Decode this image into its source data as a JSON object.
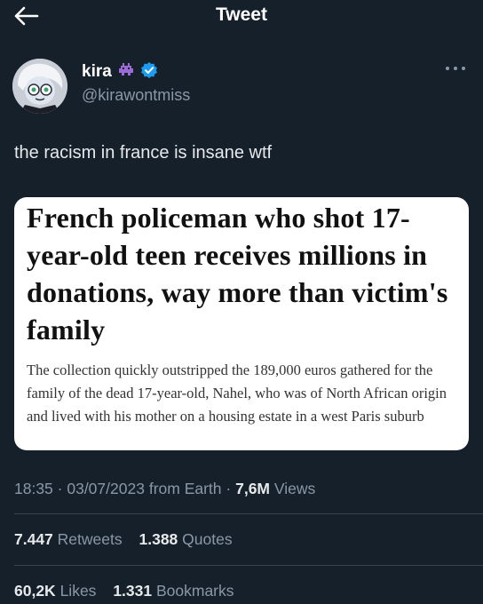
{
  "header": {
    "title": "Tweet"
  },
  "author": {
    "name": "kira",
    "handle": "@kirawontmiss",
    "verified_color": "#1d9bf0",
    "badge_emoji": "👾"
  },
  "tweet": {
    "text": "the racism in france is insane wtf",
    "card": {
      "headline": "French policeman who shot 17-year-old teen receives millions in donations, way more than victim's family",
      "lede": "The collection quickly outstripped the 189,000 euros gathered for the family of the dead 17-year-old, Nahel, who was of North African origin and lived with his mother on a housing estate in a west Paris suburb"
    },
    "time": "18:35",
    "date": "03/07/2023",
    "source": "from Earth",
    "views_count": "7,6M",
    "views_label": "Views"
  },
  "stats": {
    "retweets_count": "7.447",
    "retweets_label": "Retweets",
    "quotes_count": "1.388",
    "quotes_label": "Quotes",
    "likes_count": "60,2K",
    "likes_label": "Likes",
    "bookmarks_count": "1.331",
    "bookmarks_label": "Bookmarks"
  },
  "colors": {
    "background": "#15202b",
    "text": "#e7e9ea",
    "secondary": "#8b98a5",
    "divider": "#38444d"
  }
}
